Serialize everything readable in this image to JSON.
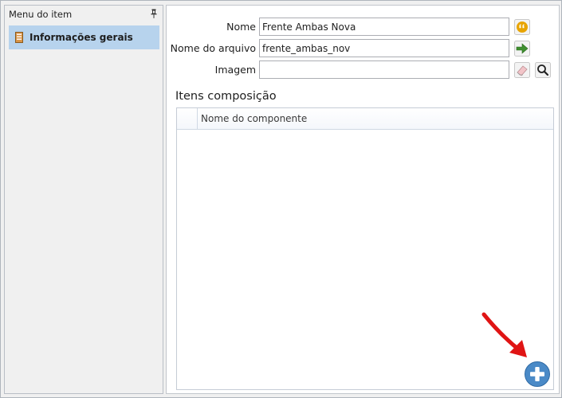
{
  "left_panel": {
    "header": "Menu do item",
    "items": [
      {
        "label": "Informações gerais",
        "icon": "book-icon",
        "selected": true
      }
    ]
  },
  "form": {
    "nome": {
      "label": "Nome",
      "value": "Frente Ambas Nova"
    },
    "arquivo": {
      "label": "Nome do arquivo",
      "value": "frente_ambas_nov"
    },
    "imagem": {
      "label": "Imagem",
      "value": ""
    }
  },
  "composition": {
    "title": "Itens composição",
    "columns": [
      "Nome do componente"
    ],
    "rows": []
  },
  "colors": {
    "selection": "#b7d3ed",
    "quote_button": "#e8a400",
    "arrow_button": "#3f8f2f",
    "add_button": "#4a8ac7",
    "annotation_arrow": "#e01414"
  },
  "icons": {
    "quote": "quote-icon",
    "go": "arrow-right-icon",
    "eraser": "eraser-icon",
    "search": "search-icon",
    "add": "plus-circle-icon",
    "pin": "pin-icon"
  }
}
